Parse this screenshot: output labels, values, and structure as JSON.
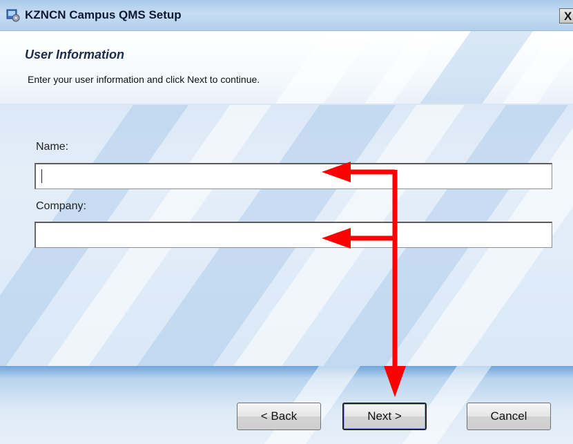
{
  "window": {
    "title": "KZNCN Campus QMS Setup",
    "close_label": "X"
  },
  "header": {
    "title": "User Information",
    "subtitle": "Enter your user information and click Next to continue."
  },
  "form": {
    "name_label": "Name:",
    "name_value": "",
    "company_label": "Company:",
    "company_value": ""
  },
  "buttons": {
    "back_label": "< Back",
    "next_label": "Next >",
    "cancel_label": "Cancel"
  },
  "annotation": {
    "arrow_color": "#ff0000"
  }
}
